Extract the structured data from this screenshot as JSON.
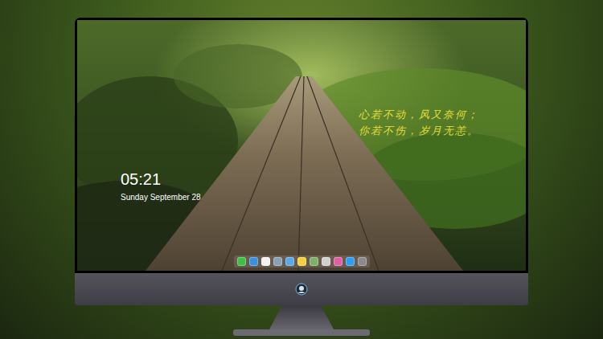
{
  "desktop": {
    "clock": {
      "time": "05:21",
      "date": "Sunday September 28"
    },
    "quote": {
      "lines": [
        "心若不动，风又奈何；",
        "你若不伤，岁月无恙。"
      ]
    }
  }
}
